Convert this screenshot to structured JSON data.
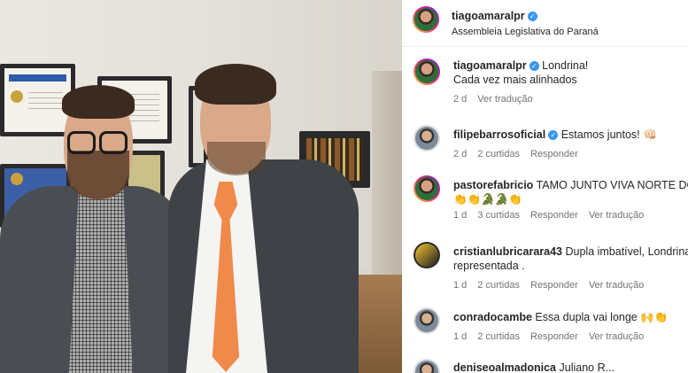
{
  "post": {
    "author": "tiagoamaralpr",
    "location": "Assembleia Legislativa do Paraná"
  },
  "caption": {
    "author": "tiagoamaralpr",
    "line1": "Londrina!",
    "line2": "Cada vez mais alinhados",
    "time": "2 d",
    "translate": "Ver tradução"
  },
  "comments": [
    {
      "user": "filipebarrosoficial",
      "verified": true,
      "text": "Estamos juntos! 👊🏻",
      "time": "2 d",
      "likes": "2 curtidas",
      "reply": "Responder",
      "translate": ""
    },
    {
      "user": "pastorefabricio",
      "verified": false,
      "text": "TAMO JUNTO VIVA NORTE DO P",
      "text2": "👏👏🐊🐊👏",
      "time": "1 d",
      "likes": "3 curtidas",
      "reply": "Responder",
      "translate": "Ver tradução"
    },
    {
      "user": "cristianlubricarara43",
      "verified": false,
      "text": "Dupla imbatível, Londrina",
      "text2": "representada .",
      "time": "1 d",
      "likes": "2 curtidas",
      "reply": "Responder",
      "translate": "Ver tradução"
    },
    {
      "user": "conradocambe",
      "verified": false,
      "text": "Essa dupla vai longe 🙌👏",
      "time": "1 d",
      "likes": "2 curtidas",
      "reply": "Responder",
      "translate": "Ver tradução"
    },
    {
      "user": "deniseoalmadonica",
      "verified": false,
      "text": "Juliano R...",
      "time": "",
      "likes": "",
      "reply": "",
      "translate": ""
    }
  ],
  "icons": {
    "verified": "verified-badge-icon"
  },
  "colors": {
    "verified": "#3797f0",
    "tie": "#f08a4b",
    "muted": "#737373"
  }
}
